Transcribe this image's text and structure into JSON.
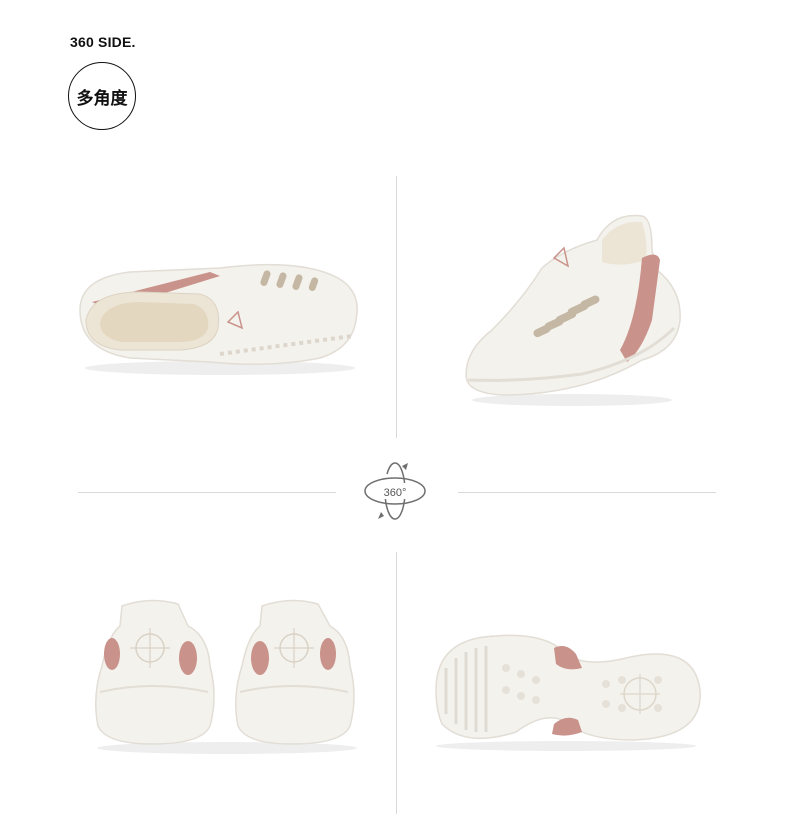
{
  "header": {
    "title": "360 SIDE.",
    "badge": "多角度"
  },
  "rotate_icon": {
    "label": "360°"
  },
  "colors": {
    "shoe_body": "#f3f1ec",
    "shoe_shadow": "#e3ddd4",
    "accent_pink": "#c9928a",
    "divider": "#d9d9d9"
  },
  "photos": [
    {
      "view": "side-top-view"
    },
    {
      "view": "front-quarter-view"
    },
    {
      "view": "rear-view-pair"
    },
    {
      "view": "sole-view"
    }
  ]
}
